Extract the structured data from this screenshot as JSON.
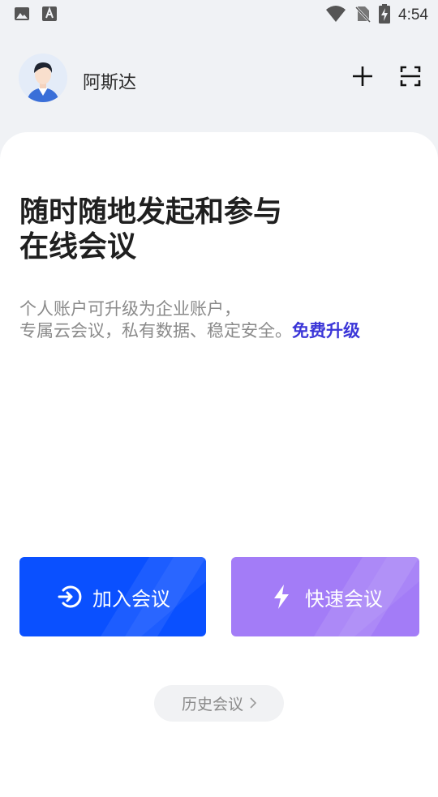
{
  "status_bar": {
    "time": "4:54",
    "left_icons": [
      "image-icon",
      "font-download-icon"
    ],
    "right_icons": [
      "wifi-icon",
      "no-sim-icon",
      "battery-charging-icon"
    ]
  },
  "header": {
    "username": "阿斯达",
    "icons": [
      "plus-icon",
      "scan-icon"
    ]
  },
  "main": {
    "headline_line1": "随时随地发起和参与",
    "headline_line2": "在线会议",
    "desc_line1": "个人账户可升级为企业账户，",
    "desc_line2": "专属云会议，私有数据、稳定安全。",
    "upgrade_link": "免费升级"
  },
  "actions": {
    "join_label": "加入会议",
    "quick_label": "快速会议",
    "history_label": "历史会议"
  },
  "colors": {
    "background": "#f0f2f5",
    "join_button": "#0a50ff",
    "quick_button": "#a37cf7",
    "link": "#3b36d8"
  }
}
